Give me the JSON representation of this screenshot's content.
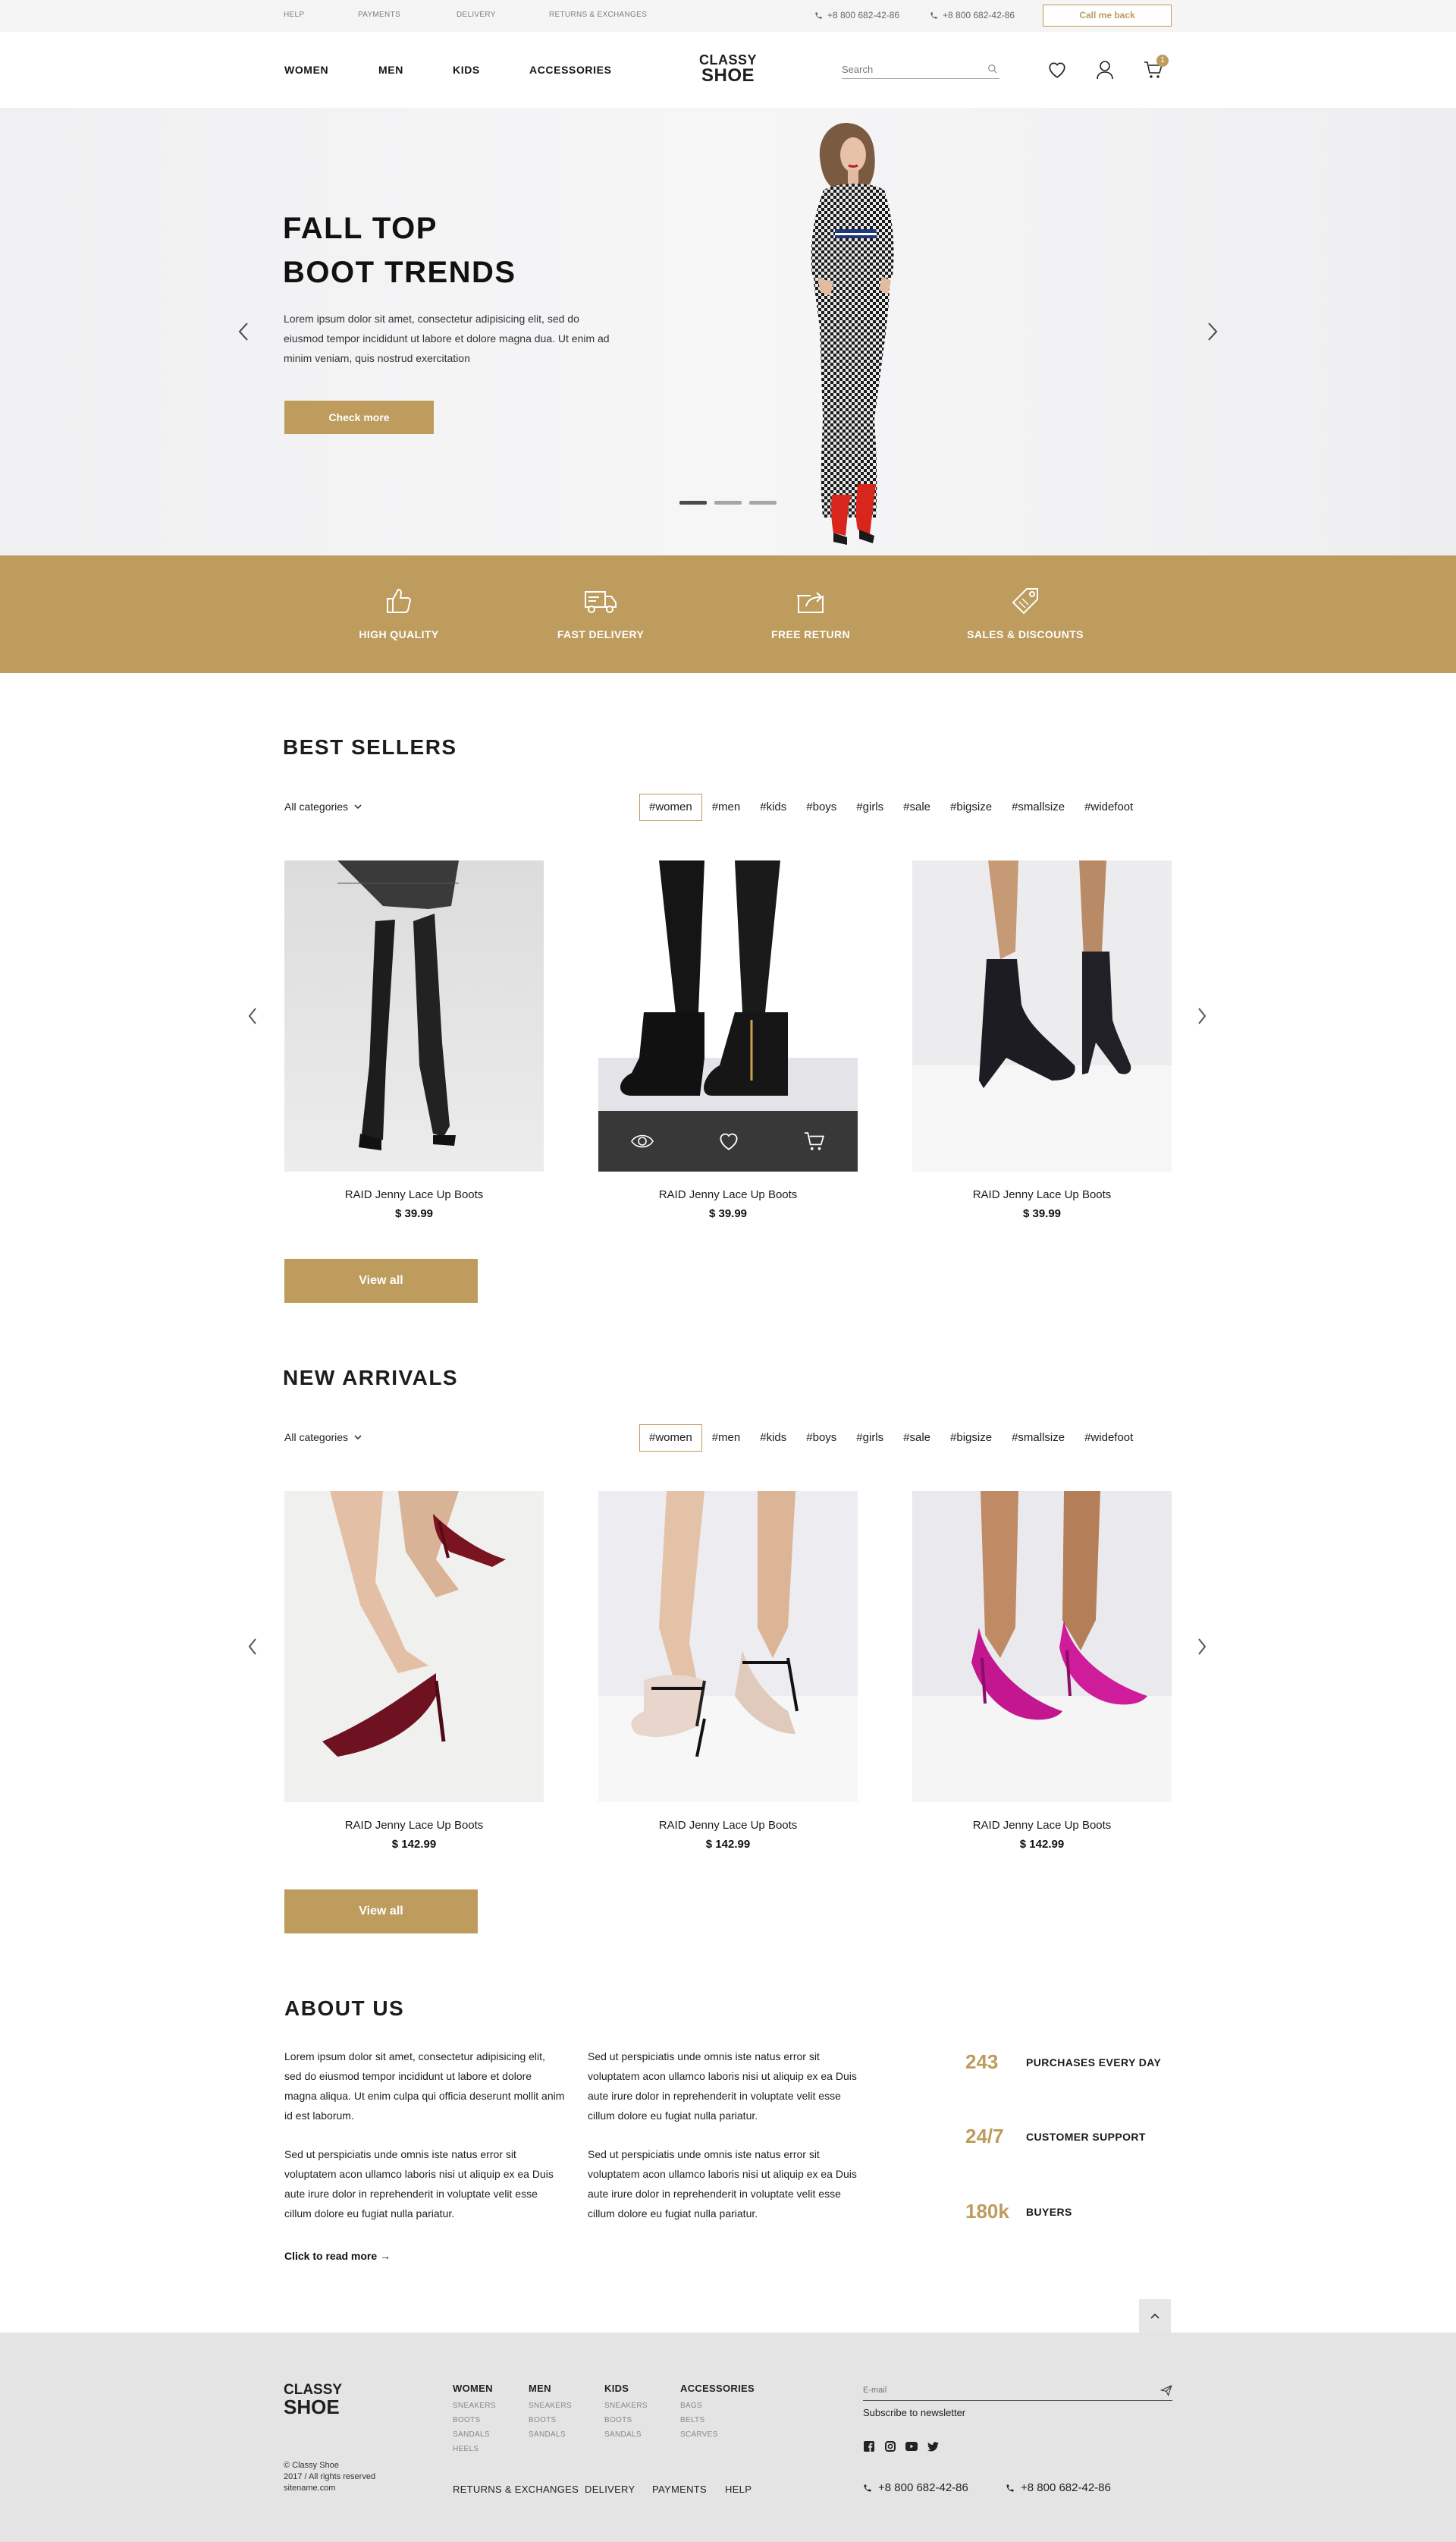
{
  "topbar": {
    "links": [
      "HELP",
      "PAYMENTS",
      "DELIVERY",
      "RETURNS & EXCHANGES"
    ],
    "phones": [
      "+8 800 682-42-86",
      "+8 800 682-42-86"
    ],
    "call_button": "Call me back"
  },
  "header": {
    "nav": [
      "WOMEN",
      "MEN",
      "KIDS",
      "ACCESSORIES"
    ],
    "logo_line1": "CLASSY",
    "logo_line2": "SHOE",
    "search_placeholder": "Search",
    "cart_count": "1"
  },
  "hero": {
    "title_line1": "FALL TOP",
    "title_line2": "BOOT TRENDS",
    "text": "Lorem ipsum dolor sit amet, consectetur adipisicing elit, sed do eiusmod tempor incididunt ut labore et dolore magna dua. Ut enim ad minim veniam, quis nostrud exercitation",
    "button": "Check more",
    "active_slide": 1,
    "slide_count": 3
  },
  "features": [
    "HIGH QUALITY",
    "FAST DELIVERY",
    "FREE RETURN",
    "SALES & DISCOUNTS"
  ],
  "best_sellers": {
    "title": "BEST SELLERS",
    "category": "All categories",
    "tags": [
      "#women",
      "#men",
      "#kids",
      "#boys",
      "#girls",
      "#sale",
      "#bigsize",
      "#smallsize",
      "#widefoot"
    ],
    "active_tag": "#women",
    "products": [
      {
        "name": "RAID Jenny Lace Up Boots",
        "price": "$ 39.99"
      },
      {
        "name": "RAID Jenny Lace Up Boots",
        "price": "$ 39.99"
      },
      {
        "name": "RAID Jenny Lace Up Boots",
        "price": "$ 39.99"
      }
    ],
    "view_all": "View all"
  },
  "new_arrivals": {
    "title": "NEW ARRIVALS",
    "category": "All categories",
    "tags": [
      "#women",
      "#men",
      "#kids",
      "#boys",
      "#girls",
      "#sale",
      "#bigsize",
      "#smallsize",
      "#widefoot"
    ],
    "active_tag": "#women",
    "products": [
      {
        "name": "RAID Jenny Lace Up Boots",
        "price": "$ 142.99"
      },
      {
        "name": "RAID Jenny Lace Up Boots",
        "price": "$ 142.99"
      },
      {
        "name": "RAID Jenny Lace Up Boots",
        "price": "$ 142.99"
      }
    ],
    "view_all": "View all"
  },
  "about": {
    "title": "ABOUT US",
    "p1": "Lorem ipsum dolor sit amet, consectetur adipisicing elit, sed do eiusmod tempor incididunt ut labore et dolore magna aliqua. Ut enim culpa qui officia deserunt mollit anim id est laborum.",
    "p2": "Sed ut perspiciatis unde omnis iste natus error sit voluptatem acon ullamco laboris nisi ut aliquip ex ea Duis aute irure dolor in reprehenderit in voluptate velit esse cillum dolore eu fugiat nulla pariatur.",
    "p3": "Sed ut perspiciatis unde omnis iste natus error sit voluptatem acon ullamco laboris nisi ut aliquip ex ea Duis aute irure dolor in reprehenderit in voluptate velit esse cillum dolore eu fugiat nulla pariatur.",
    "p4": "Sed ut perspiciatis unde omnis iste natus error sit voluptatem acon ullamco laboris nisi ut aliquip ex ea Duis aute irure dolor in reprehenderit in voluptate velit esse cillum dolore eu fugiat nulla pariatur.",
    "read_more": "Click to read more →",
    "stats": [
      {
        "number": "243",
        "label": "PURCHASES EVERY DAY"
      },
      {
        "number": "24/7",
        "label": "CUSTOMER SUPPORT"
      },
      {
        "number": "180k",
        "label": "BUYERS"
      }
    ]
  },
  "footer": {
    "logo_line1": "CLASSY",
    "logo_line2": "SHOE",
    "copyright": [
      "© Classy Shoe",
      "2017 / All rights reserved",
      "sitename.com"
    ],
    "columns": [
      {
        "title": "WOMEN",
        "items": [
          "SNEAKERS",
          "BOOTS",
          "SANDALS",
          "HEELS"
        ]
      },
      {
        "title": "MEN",
        "items": [
          "SNEAKERS",
          "BOOTS",
          "SANDALS"
        ]
      },
      {
        "title": "KIDS",
        "items": [
          "SNEAKERS",
          "BOOTS",
          "SANDALS"
        ]
      },
      {
        "title": "ACCESSORIES",
        "items": [
          "BAGS",
          "BELTS",
          "SCARVES"
        ]
      }
    ],
    "bottom_links": [
      "RETURNS & EXCHANGES",
      "DELIVERY",
      "PAYMENTS",
      "HELP"
    ],
    "email_placeholder": "E-mail",
    "subscribe": "Subscribe to newsletter",
    "phones": [
      "+8 800 682-42-86",
      "+8 800 682-42-86"
    ]
  },
  "colors": {
    "accent": "#bd9c5d",
    "dark": "#1c1c1c",
    "footer_bg": "#e4e4e4",
    "topbar_bg": "#f5f5f5"
  },
  "icons": [
    "phone-icon",
    "search-icon",
    "heart-icon",
    "user-icon",
    "cart-icon",
    "chevron-left-icon",
    "chevron-right-icon",
    "thumbs-up-icon",
    "truck-icon",
    "return-box-icon",
    "tag-icon",
    "eye-icon",
    "send-icon",
    "facebook-icon",
    "instagram-icon",
    "youtube-icon",
    "twitter-icon",
    "chevron-up-icon"
  ]
}
